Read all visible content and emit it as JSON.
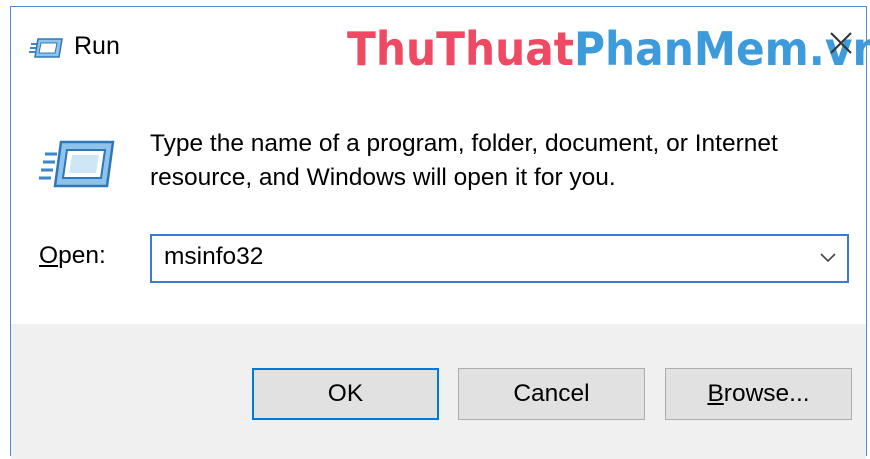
{
  "window": {
    "title": "Run",
    "watermark_part1": "ThuThuat",
    "watermark_part2": "PhanMem.vn",
    "watermark_colors": {
      "part1": "#ef4a63",
      "part2": "#3d9bdc"
    },
    "title_icon": "run-icon",
    "close_icon": "close-icon"
  },
  "content": {
    "icon": "run-icon",
    "description_line1": "Type the name of a program, folder, document, or Internet",
    "description_line2": "resource, and Windows will open it for you.",
    "open_label_mnemonic": "O",
    "open_label_rest": "pen:",
    "open_value": "msinfo32",
    "dropdown_icon": "chevron-down-icon"
  },
  "buttons": {
    "ok": "OK",
    "cancel": "Cancel",
    "browse_mnemonic": "B",
    "browse_rest": "rowse..."
  },
  "colors": {
    "accent": "#0078d7",
    "footer_bg": "#f0f0f0",
    "button_bg": "#e1e1e1"
  }
}
